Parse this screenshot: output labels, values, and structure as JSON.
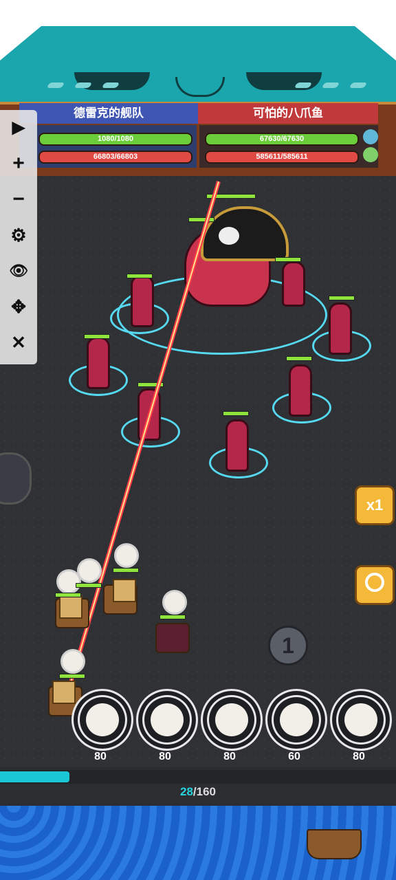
{
  "header": {
    "left_team": "德雷克的舰队",
    "right_team": "可怕的八爪鱼",
    "left_hp": "1080/1080",
    "left_shield": "66803/66803",
    "right_hp": "67630/67630",
    "right_shield": "585611/585611"
  },
  "toolbar": {
    "play": "▶",
    "zoom_in": "+",
    "zoom_out": "−",
    "settings": "⚙",
    "hide": "👁",
    "move": "✥",
    "close": "✕"
  },
  "controls": {
    "speed_label": "x1",
    "search_icon": "magnifier-icon",
    "target_number": "1"
  },
  "skills": [
    {
      "cost": "80",
      "icon": "cannon-icon"
    },
    {
      "cost": "80",
      "icon": "fire-icon"
    },
    {
      "cost": "80",
      "icon": "bomb-icon"
    },
    {
      "cost": "60",
      "icon": "gear-icon"
    },
    {
      "cost": "80",
      "icon": "swirl-icon"
    }
  ],
  "progress": {
    "current": "28",
    "total": "/160",
    "fraction": 0.175
  },
  "colors": {
    "accent_teal": "#1aa6ac",
    "hp_green": "#6ccd3b",
    "shield_red": "#e04a44",
    "progress_cyan": "#19c8d4"
  }
}
